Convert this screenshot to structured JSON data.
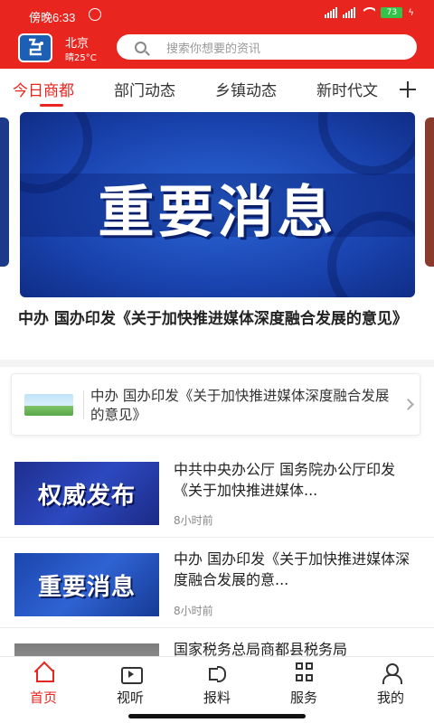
{
  "status_bar": {
    "time": "傍晚6:33",
    "battery": "73"
  },
  "header": {
    "logo_text": "今日商都",
    "city": "北京",
    "weather": "晴25°C",
    "search_placeholder": "搜索你想要的资讯"
  },
  "tabs": [
    {
      "label": "今日商都",
      "active": true
    },
    {
      "label": "部门动态",
      "active": false
    },
    {
      "label": "乡镇动态",
      "active": false
    },
    {
      "label": "新时代文",
      "active": false
    }
  ],
  "carousel": {
    "banner_text": "重要消息",
    "headline": "中办  国办印发《关于加快推进媒体深度融合发展的意见》"
  },
  "link_card": {
    "text": "中办  国办印发《关于加快推进媒体深度融合发展的意见》"
  },
  "news": [
    {
      "image_text": "权威发布",
      "title": "中共中央办公厅  国务院办公厅印发《关于加快推进媒体...",
      "time": "8小时前"
    },
    {
      "image_text": "重要消息",
      "title": "中办  国办印发《关于加快推进媒体深度融合发展的意...",
      "time": "8小时前"
    },
    {
      "image_text": "",
      "title": "国家税务总局商都县税务局",
      "time": ""
    }
  ],
  "bottom_nav": [
    {
      "label": "首页",
      "icon": "home-icon",
      "active": true
    },
    {
      "label": "视听",
      "icon": "tv-icon",
      "active": false
    },
    {
      "label": "报料",
      "icon": "speaker-icon",
      "active": false
    },
    {
      "label": "服务",
      "icon": "grid-icon",
      "active": false
    },
    {
      "label": "我的",
      "icon": "user-icon",
      "active": false
    }
  ],
  "colors": {
    "brand_red": "#e8261f",
    "banner_blue": "#1a44b0"
  }
}
